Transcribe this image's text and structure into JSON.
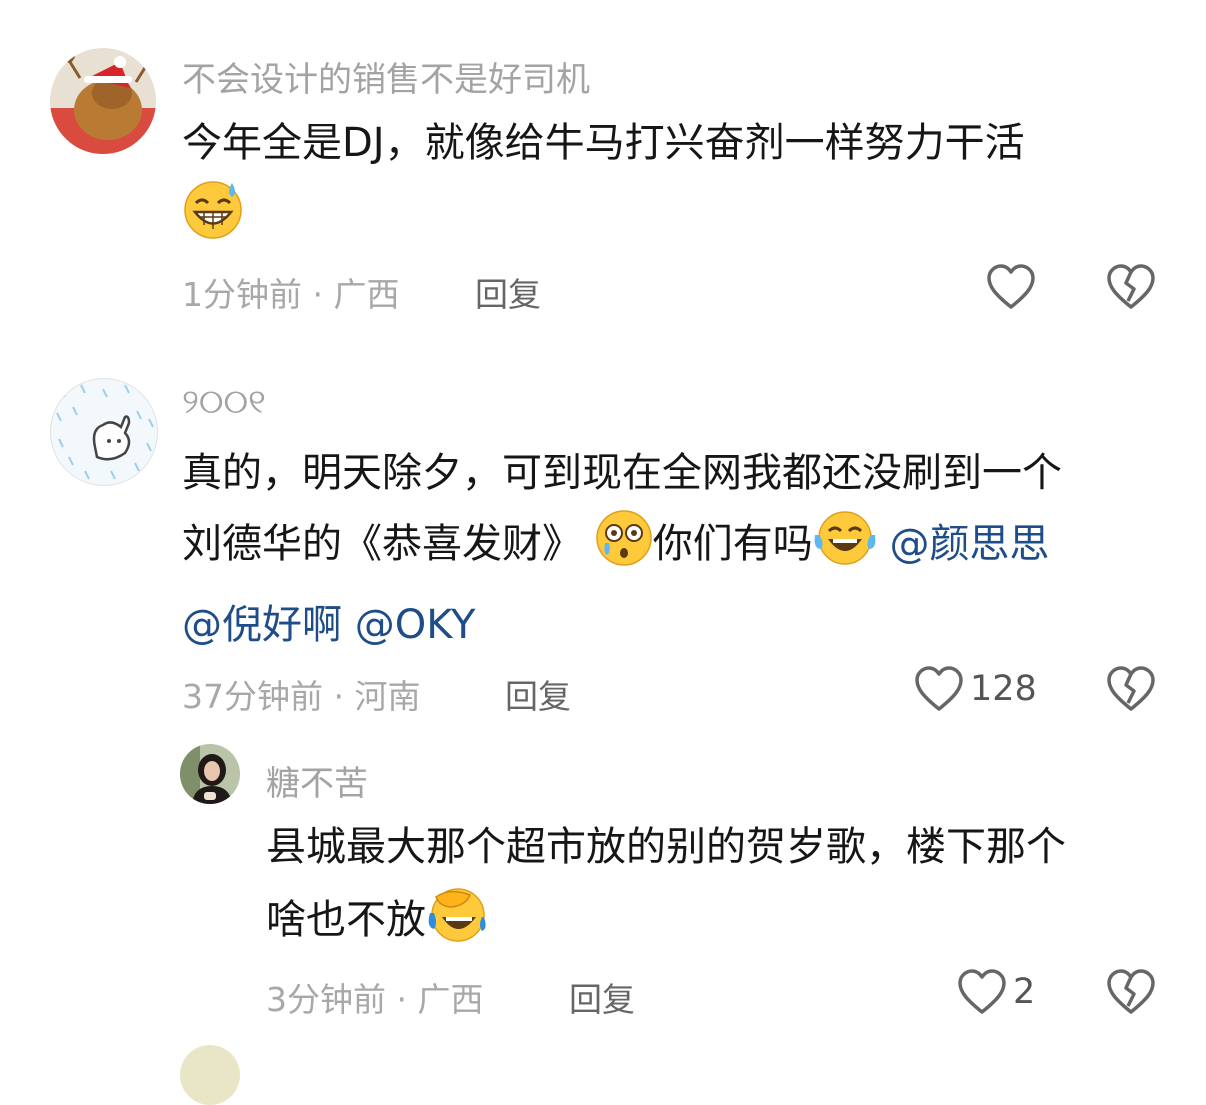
{
  "comments": [
    {
      "username": "不会设计的销售不是好司机",
      "text_line1": "今年全是DJ，就像给牛马打兴奋剂一样努力干活",
      "time": "1分钟前",
      "location": "广西",
      "reply_label": "回复"
    },
    {
      "username": "୨୦୦୧",
      "text_line1": "真的，明天除夕，可到现在全网我都还没刷到一个",
      "text_line2_a": "刘德华的《恭喜发财》",
      "text_line2_b": "你们有吗",
      "mentions": [
        "@颜思思",
        "@倪好啊",
        "@OKY"
      ],
      "time": "37分钟前",
      "location": "河南",
      "reply_label": "回复",
      "like_count": "128"
    }
  ],
  "reply": {
    "username": "糖不苦",
    "text_line1": "县城最大那个超市放的别的贺岁歌，楼下那个",
    "text_line2": "啥也不放",
    "time": "3分钟前",
    "location": "广西",
    "reply_label": "回复",
    "like_count": "2"
  },
  "separator": "·",
  "icons": {
    "like": "heart-outline-icon",
    "dislike": "broken-heart-icon",
    "emoji_sweat_smile": "grinning-sweat-emoji",
    "emoji_flushed": "flushed-emoji",
    "emoji_laugh_cry": "tears-of-joy-emoji",
    "emoji_facepalm": "facepalm-laugh-emoji"
  },
  "colors": {
    "mention": "#1f4d8a",
    "meta": "#a8a8a8",
    "name": "#a3a3a3"
  }
}
